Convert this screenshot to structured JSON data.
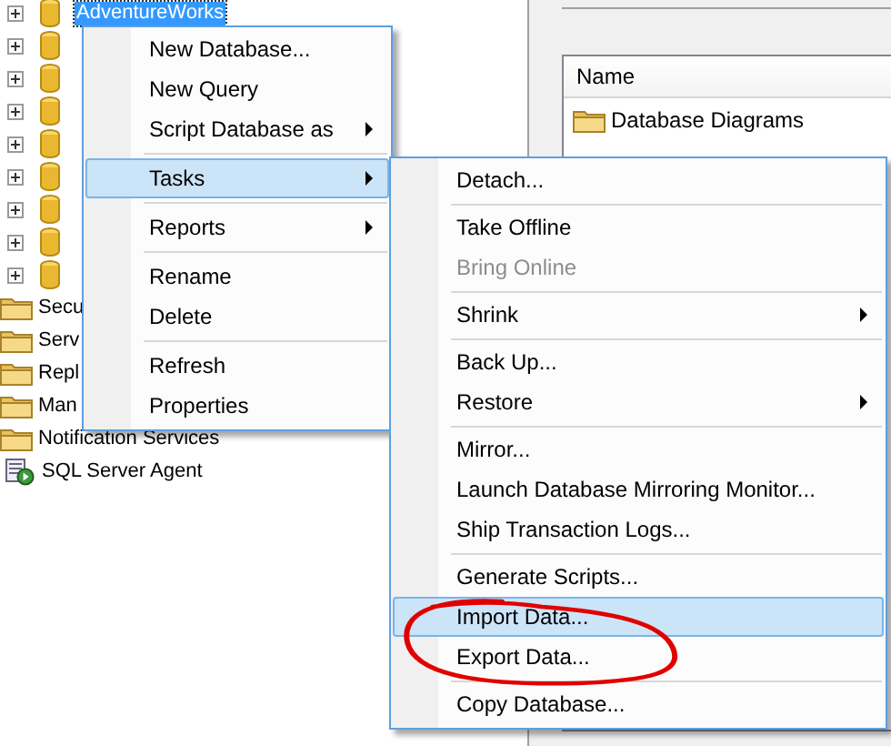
{
  "tree": [
    {
      "label": "AdventureWorks",
      "kind": "database",
      "expandable": true,
      "selected": true
    },
    {
      "kind": "database",
      "expandable": true
    },
    {
      "kind": "database",
      "expandable": true
    },
    {
      "kind": "database",
      "expandable": true
    },
    {
      "kind": "database",
      "expandable": true
    },
    {
      "kind": "database",
      "expandable": true
    },
    {
      "kind": "database",
      "expandable": true
    },
    {
      "kind": "database",
      "expandable": true
    },
    {
      "kind": "database",
      "expandable": true
    },
    {
      "label": "Secu",
      "kind": "folder",
      "expandable": false,
      "selected": false
    },
    {
      "label": "Serv",
      "kind": "folder",
      "expandable": false,
      "selected": false
    },
    {
      "label": "Repl",
      "kind": "folder",
      "expandable": false,
      "selected": false
    },
    {
      "label": "Man",
      "kind": "folder",
      "expandable": false,
      "selected": false
    },
    {
      "label": "Notification Services",
      "kind": "folder",
      "expandable": false,
      "selected": false
    },
    {
      "label": "SQL Server Agent",
      "kind": "agent",
      "expandable": false,
      "selected": false
    }
  ],
  "list_panel": {
    "column": "Name",
    "rows": [
      {
        "label": "Database Diagrams"
      }
    ]
  },
  "context_menu": {
    "items": [
      {
        "kind": "item",
        "label": "New Database...",
        "submenu": false,
        "selected": false,
        "disabled": false
      },
      {
        "kind": "item",
        "label": "New Query",
        "submenu": false,
        "selected": false,
        "disabled": false
      },
      {
        "kind": "item",
        "label": "Script Database as",
        "submenu": true,
        "selected": false,
        "disabled": false
      },
      {
        "kind": "separator"
      },
      {
        "kind": "item",
        "label": "Tasks",
        "submenu": true,
        "selected": true,
        "disabled": false
      },
      {
        "kind": "separator"
      },
      {
        "kind": "item",
        "label": "Reports",
        "submenu": true,
        "selected": false,
        "disabled": false
      },
      {
        "kind": "separator"
      },
      {
        "kind": "item",
        "label": "Rename",
        "submenu": false,
        "selected": false,
        "disabled": false
      },
      {
        "kind": "item",
        "label": "Delete",
        "submenu": false,
        "selected": false,
        "disabled": false
      },
      {
        "kind": "separator"
      },
      {
        "kind": "item",
        "label": "Refresh",
        "submenu": false,
        "selected": false,
        "disabled": false
      },
      {
        "kind": "item",
        "label": "Properties",
        "submenu": false,
        "selected": false,
        "disabled": false
      }
    ]
  },
  "tasks_submenu": {
    "items": [
      {
        "kind": "item",
        "label": "Detach...",
        "submenu": false,
        "selected": false,
        "disabled": false
      },
      {
        "kind": "separator"
      },
      {
        "kind": "item",
        "label": "Take Offline",
        "submenu": false,
        "selected": false,
        "disabled": false
      },
      {
        "kind": "item",
        "label": "Bring Online",
        "submenu": false,
        "selected": false,
        "disabled": true
      },
      {
        "kind": "separator"
      },
      {
        "kind": "item",
        "label": "Shrink",
        "submenu": true,
        "selected": false,
        "disabled": false
      },
      {
        "kind": "separator"
      },
      {
        "kind": "item",
        "label": "Back Up...",
        "submenu": false,
        "selected": false,
        "disabled": false
      },
      {
        "kind": "item",
        "label": "Restore",
        "submenu": true,
        "selected": false,
        "disabled": false
      },
      {
        "kind": "separator"
      },
      {
        "kind": "item",
        "label": "Mirror...",
        "submenu": false,
        "selected": false,
        "disabled": false
      },
      {
        "kind": "item",
        "label": "Launch Database Mirroring Monitor...",
        "submenu": false,
        "selected": false,
        "disabled": false
      },
      {
        "kind": "item",
        "label": "Ship Transaction Logs...",
        "submenu": false,
        "selected": false,
        "disabled": false
      },
      {
        "kind": "separator"
      },
      {
        "kind": "item",
        "label": "Generate Scripts...",
        "submenu": false,
        "selected": false,
        "disabled": false
      },
      {
        "kind": "item",
        "label": "Import Data...",
        "submenu": false,
        "selected": true,
        "disabled": false
      },
      {
        "kind": "item",
        "label": "Export Data...",
        "submenu": false,
        "selected": false,
        "disabled": false
      },
      {
        "kind": "separator"
      },
      {
        "kind": "item",
        "label": "Copy Database...",
        "submenu": false,
        "selected": false,
        "disabled": false
      }
    ]
  },
  "annotation": {
    "kind": "ellipse"
  }
}
